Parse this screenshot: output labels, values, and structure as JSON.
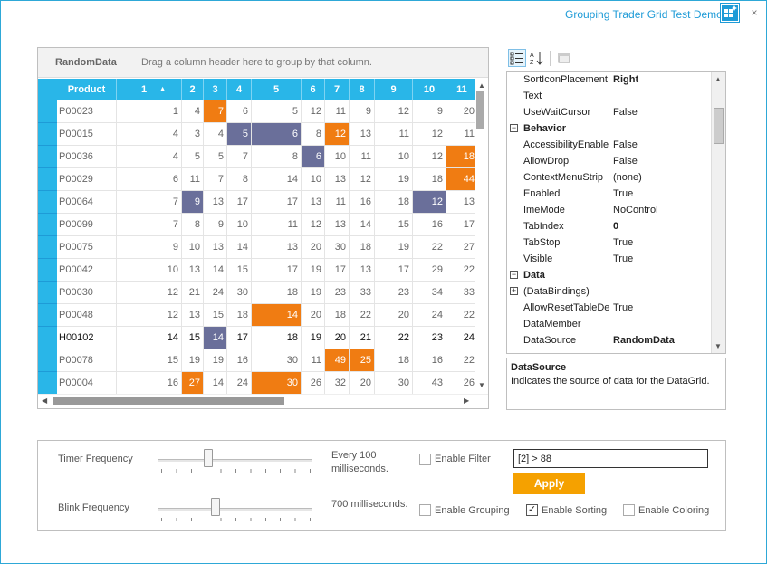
{
  "window": {
    "title": "Grouping Trader Grid Test Demo",
    "close_glyph": "×",
    "app_icon": "grid-sparkle-icon"
  },
  "grid": {
    "group_panel_title": "RandomData",
    "group_panel_hint": "Drag a column header here to group by that column.",
    "columns": [
      "Product",
      "1",
      "2",
      "3",
      "4",
      "5",
      "6",
      "7",
      "8",
      "9",
      "10",
      "11"
    ],
    "sort_indicator": "▲",
    "rows": [
      {
        "product": "P00023",
        "values": [
          "1",
          "4",
          "7",
          "6",
          "5",
          "12",
          "11",
          "9",
          "12",
          "9",
          "20"
        ],
        "bold": false,
        "hl": {
          "3": "orange"
        }
      },
      {
        "product": "P00015",
        "values": [
          "4",
          "3",
          "4",
          "5",
          "6",
          "8",
          "12",
          "13",
          "11",
          "12",
          "11"
        ],
        "bold": false,
        "hl": {
          "4": "slate",
          "5": "slate",
          "7": "orange"
        }
      },
      {
        "product": "P00036",
        "values": [
          "4",
          "5",
          "5",
          "7",
          "8",
          "6",
          "10",
          "11",
          "10",
          "12",
          "18"
        ],
        "bold": false,
        "hl": {
          "6": "slate",
          "11": "orange"
        }
      },
      {
        "product": "P00029",
        "values": [
          "6",
          "11",
          "7",
          "8",
          "14",
          "10",
          "13",
          "12",
          "19",
          "18",
          "44"
        ],
        "bold": false,
        "hl": {
          "11": "orange"
        }
      },
      {
        "product": "P00064",
        "values": [
          "7",
          "9",
          "13",
          "17",
          "17",
          "13",
          "11",
          "16",
          "18",
          "12",
          "13"
        ],
        "bold": false,
        "hl": {
          "2": "slate",
          "10": "slate"
        }
      },
      {
        "product": "P00099",
        "values": [
          "7",
          "8",
          "9",
          "10",
          "11",
          "12",
          "13",
          "14",
          "15",
          "16",
          "17"
        ],
        "bold": false,
        "hl": {}
      },
      {
        "product": "P00075",
        "values": [
          "9",
          "10",
          "13",
          "14",
          "13",
          "20",
          "30",
          "18",
          "19",
          "22",
          "27"
        ],
        "bold": false,
        "hl": {}
      },
      {
        "product": "P00042",
        "values": [
          "10",
          "13",
          "14",
          "15",
          "17",
          "19",
          "17",
          "13",
          "17",
          "29",
          "22"
        ],
        "bold": false,
        "hl": {}
      },
      {
        "product": "P00030",
        "values": [
          "12",
          "21",
          "24",
          "30",
          "18",
          "19",
          "23",
          "33",
          "23",
          "34",
          "33"
        ],
        "bold": false,
        "hl": {}
      },
      {
        "product": "P00048",
        "values": [
          "12",
          "13",
          "15",
          "18",
          "14",
          "20",
          "18",
          "22",
          "20",
          "24",
          "22"
        ],
        "bold": false,
        "hl": {
          "5": "orange"
        }
      },
      {
        "product": "H00102",
        "values": [
          "14",
          "15",
          "14",
          "17",
          "18",
          "19",
          "20",
          "21",
          "22",
          "23",
          "24"
        ],
        "bold": true,
        "hl": {
          "3": "slate"
        }
      },
      {
        "product": "P00078",
        "values": [
          "15",
          "19",
          "19",
          "16",
          "30",
          "11",
          "49",
          "25",
          "18",
          "16",
          "22"
        ],
        "bold": false,
        "hl": {
          "7": "orange",
          "8": "orange"
        }
      },
      {
        "product": "P00004",
        "values": [
          "16",
          "27",
          "14",
          "24",
          "30",
          "26",
          "32",
          "20",
          "30",
          "43",
          "26"
        ],
        "bold": false,
        "hl": {
          "2": "orange",
          "5": "orange"
        }
      }
    ]
  },
  "propgrid": {
    "toolbar": {
      "categorized_icon": "categorized-icon",
      "alpha_icon": "alphabetical-sort-icon",
      "pages_icon": "property-pages-icon"
    },
    "rows": [
      {
        "type": "prop",
        "name": "SortIconPlacement",
        "value": "Right",
        "bold": true
      },
      {
        "type": "prop",
        "name": "Text",
        "value": "",
        "bold": false
      },
      {
        "type": "prop",
        "name": "UseWaitCursor",
        "value": "False",
        "bold": false
      },
      {
        "type": "cat",
        "name": "Behavior",
        "value": "",
        "bold": true,
        "exp": "−"
      },
      {
        "type": "prop",
        "name": "AccessibilityEnable",
        "value": "False",
        "bold": false
      },
      {
        "type": "prop",
        "name": "AllowDrop",
        "value": "False",
        "bold": false
      },
      {
        "type": "prop",
        "name": "ContextMenuStrip",
        "value": "(none)",
        "bold": false
      },
      {
        "type": "prop",
        "name": "Enabled",
        "value": "True",
        "bold": false
      },
      {
        "type": "prop",
        "name": "ImeMode",
        "value": "NoControl",
        "bold": false
      },
      {
        "type": "prop",
        "name": "TabIndex",
        "value": "0",
        "bold": true
      },
      {
        "type": "prop",
        "name": "TabStop",
        "value": "True",
        "bold": false
      },
      {
        "type": "prop",
        "name": "Visible",
        "value": "True",
        "bold": false
      },
      {
        "type": "cat",
        "name": "Data",
        "value": "",
        "bold": true,
        "exp": "−"
      },
      {
        "type": "sub",
        "name": "(DataBindings)",
        "value": "",
        "bold": false,
        "exp": "+"
      },
      {
        "type": "prop",
        "name": "AllowResetTableDe",
        "value": "True",
        "bold": false
      },
      {
        "type": "prop",
        "name": "DataMember",
        "value": "",
        "bold": false
      },
      {
        "type": "prop",
        "name": "DataSource",
        "value": "RandomData",
        "bold": true
      }
    ],
    "description_title": "DataSource",
    "description_text": "Indicates the source of data for the DataGrid."
  },
  "options": {
    "timer_label": "Timer Frequency",
    "timer_value_text_1": "Every 100",
    "timer_value_text_2": "milliseconds.",
    "blink_label": "Blink Frequency",
    "blink_value_text": "700 milliseconds.",
    "timer_level": 0.31,
    "blink_level": 0.36,
    "enable_filter_label": "Enable Filter",
    "enable_filter_checked": false,
    "filter_value": "[2] > 88",
    "apply_label": "Apply",
    "enable_grouping_label": "Enable Grouping",
    "enable_grouping_checked": false,
    "enable_sorting_label": "Enable Sorting",
    "enable_sorting_checked": true,
    "enable_coloring_label": "Enable Coloring",
    "enable_coloring_checked": false,
    "check_glyph": "✓"
  },
  "colors": {
    "accent": "#29b6e8",
    "orange": "#f07c12",
    "slate": "#6a6f9a",
    "apply": "#f5a100",
    "title": "#1e9bd7"
  }
}
